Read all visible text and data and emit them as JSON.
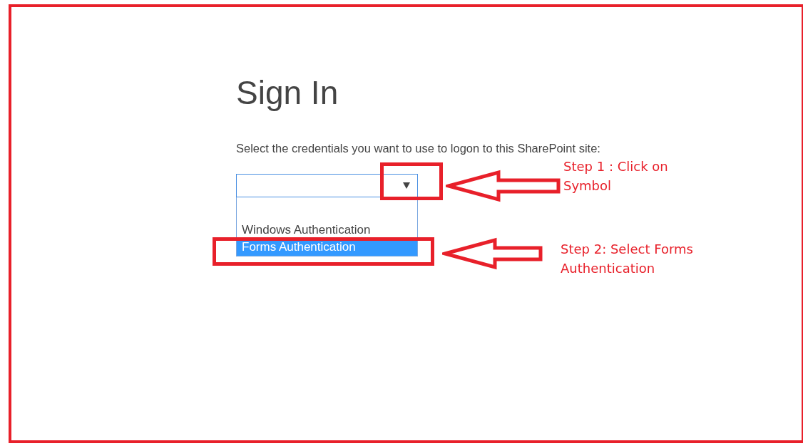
{
  "title": "Sign In",
  "prompt": "Select the credentials you want to use to logon to this SharePoint site:",
  "select": {
    "expanded": true,
    "options": [
      {
        "label": "Windows Authentication",
        "selected": false
      },
      {
        "label": "Forms Authentication",
        "selected": true
      }
    ]
  },
  "annotations": [
    {
      "text": "Step 1 : Click on Symbol"
    },
    {
      "text": "Step 2: Select Forms Authentication"
    }
  ]
}
